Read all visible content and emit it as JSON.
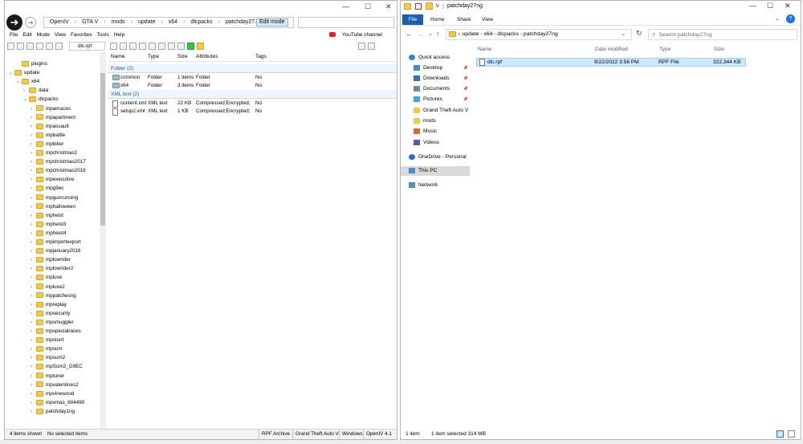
{
  "openiv": {
    "breadcrumbs": [
      "OpenIV",
      "GTA V",
      "mods",
      "update",
      "x64",
      "dlcpacks",
      "patchday27..."
    ],
    "edit_mode": "Edit mode",
    "menu": [
      "File",
      "Edit",
      "Mode",
      "View",
      "Favorites",
      "Tools",
      "Help"
    ],
    "youtube": "YouTube channel",
    "current_path": "dlc.rpf",
    "tree": [
      {
        "label": "plugins",
        "indent": 2,
        "exp": ""
      },
      {
        "label": "update",
        "indent": 1,
        "exp": "v"
      },
      {
        "label": "x64",
        "indent": 2,
        "exp": "v"
      },
      {
        "label": "data",
        "indent": 3,
        "exp": ">"
      },
      {
        "label": "dlcpacks",
        "indent": 3,
        "exp": "v"
      },
      {
        "label": "mpairraces",
        "indent": 4,
        "exp": ">"
      },
      {
        "label": "mpapartment",
        "indent": 4,
        "exp": ">"
      },
      {
        "label": "mpassault",
        "indent": 4,
        "exp": ">"
      },
      {
        "label": "mpbattle",
        "indent": 4,
        "exp": ">"
      },
      {
        "label": "mpbiker",
        "indent": 4,
        "exp": ">"
      },
      {
        "label": "mpchristmas2",
        "indent": 4,
        "exp": ">"
      },
      {
        "label": "mpchristmas2017",
        "indent": 4,
        "exp": ">"
      },
      {
        "label": "mpchristmas2018",
        "indent": 4,
        "exp": ">"
      },
      {
        "label": "mpexecutive",
        "indent": 4,
        "exp": ">"
      },
      {
        "label": "mpg9ec",
        "indent": 4,
        "exp": ">"
      },
      {
        "label": "mpgunrunning",
        "indent": 4,
        "exp": ">"
      },
      {
        "label": "mphalloween",
        "indent": 4,
        "exp": ">"
      },
      {
        "label": "mpheist",
        "indent": 4,
        "exp": ">"
      },
      {
        "label": "mpheist3",
        "indent": 4,
        "exp": ">"
      },
      {
        "label": "mpheist4",
        "indent": 4,
        "exp": ">"
      },
      {
        "label": "mpimportexport",
        "indent": 4,
        "exp": ">"
      },
      {
        "label": "mpjanuary2016",
        "indent": 4,
        "exp": ">"
      },
      {
        "label": "mplowrider",
        "indent": 4,
        "exp": ">"
      },
      {
        "label": "mplowrider2",
        "indent": 4,
        "exp": ">"
      },
      {
        "label": "mpluxe",
        "indent": 4,
        "exp": ">"
      },
      {
        "label": "mpluxe2",
        "indent": 4,
        "exp": ">"
      },
      {
        "label": "mppatchesng",
        "indent": 4,
        "exp": ">"
      },
      {
        "label": "mpreplay",
        "indent": 4,
        "exp": ">"
      },
      {
        "label": "mpsecurity",
        "indent": 4,
        "exp": ">"
      },
      {
        "label": "mpsmuggler",
        "indent": 4,
        "exp": ">"
      },
      {
        "label": "mpspecialraces",
        "indent": 4,
        "exp": ">"
      },
      {
        "label": "mpstunt",
        "indent": 4,
        "exp": ">"
      },
      {
        "label": "mpsum",
        "indent": 4,
        "exp": ">"
      },
      {
        "label": "mpsum2",
        "indent": 4,
        "exp": ">"
      },
      {
        "label": "mpSum2_G9EC",
        "indent": 4,
        "exp": ">"
      },
      {
        "label": "mptuner",
        "indent": 4,
        "exp": ">"
      },
      {
        "label": "mpvalentines2",
        "indent": 4,
        "exp": ">"
      },
      {
        "label": "mpvinewood",
        "indent": 4,
        "exp": ">"
      },
      {
        "label": "mpxmas_604490",
        "indent": 4,
        "exp": ">"
      },
      {
        "label": "patchday1ng",
        "indent": 4,
        "exp": ">"
      }
    ],
    "columns": [
      "Name",
      "Type",
      "Size",
      "Attributes",
      "Tags"
    ],
    "groups": [
      {
        "title": "Folder (2)",
        "items": [
          {
            "name": "common",
            "type": "Folder",
            "size": "1 items",
            "attr": "Folder",
            "tags": "No",
            "kind": "folder"
          },
          {
            "name": "x64",
            "type": "Folder",
            "size": "3 items",
            "attr": "Folder",
            "tags": "No",
            "kind": "folder"
          }
        ]
      },
      {
        "title": "XML text (2)",
        "items": [
          {
            "name": "content.xml",
            "type": "XML text",
            "size": "22 KB",
            "attr": "Compressed;Encrypted;",
            "tags": "No",
            "kind": "file"
          },
          {
            "name": "setup2.xml",
            "type": "XML text",
            "size": "1 KB",
            "attr": "Compressed;Encrypted;",
            "tags": "No",
            "kind": "file"
          }
        ]
      }
    ],
    "status": [
      "4 items shown",
      "No selected items",
      "RPF Archive",
      "Grand Theft Auto V",
      "Windows",
      "OpenIV 4.1"
    ]
  },
  "explorer": {
    "title": "patchday27ng",
    "title_prefix": "v",
    "ribbon": [
      "File",
      "Home",
      "Share",
      "View"
    ],
    "address": [
      "update",
      "x64",
      "dlcpacks",
      "patchday27ng"
    ],
    "search_placeholder": "Search patchday27ng",
    "nav": [
      {
        "label": "Quick access",
        "color": "#2b88d8",
        "pin": false
      },
      {
        "label": "Desktop",
        "color": "#3b8fd6",
        "pin": true
      },
      {
        "label": "Downloads",
        "color": "#2a73c7",
        "pin": true
      },
      {
        "label": "Documents",
        "color": "#7d8792",
        "pin": true
      },
      {
        "label": "Pictures",
        "color": "#3da5e0",
        "pin": true
      },
      {
        "label": "Grand Theft Auto V",
        "color": "#f4c94a",
        "pin": false
      },
      {
        "label": "mods",
        "color": "#f4c94a",
        "pin": false
      },
      {
        "label": "Music",
        "color": "#d46c2e",
        "pin": false
      },
      {
        "label": "Videos",
        "color": "#6b4fbb",
        "pin": false
      },
      {
        "label": "OneDrive - Personal",
        "color": "#1976d2",
        "pin": false
      },
      {
        "label": "This PC",
        "color": "#4d8ec9",
        "pin": false
      },
      {
        "label": "Network",
        "color": "#4d8ec9",
        "pin": false
      }
    ],
    "columns": [
      "Name",
      "Date modified",
      "Type",
      "Size"
    ],
    "files": [
      {
        "name": "dlc.rpf",
        "date": "9/22/2022 3:56 PM",
        "type": "RPF File",
        "size": "322,344 KB"
      }
    ],
    "status": {
      "count": "1 item",
      "selected": "1 item selected  314 MB"
    }
  }
}
